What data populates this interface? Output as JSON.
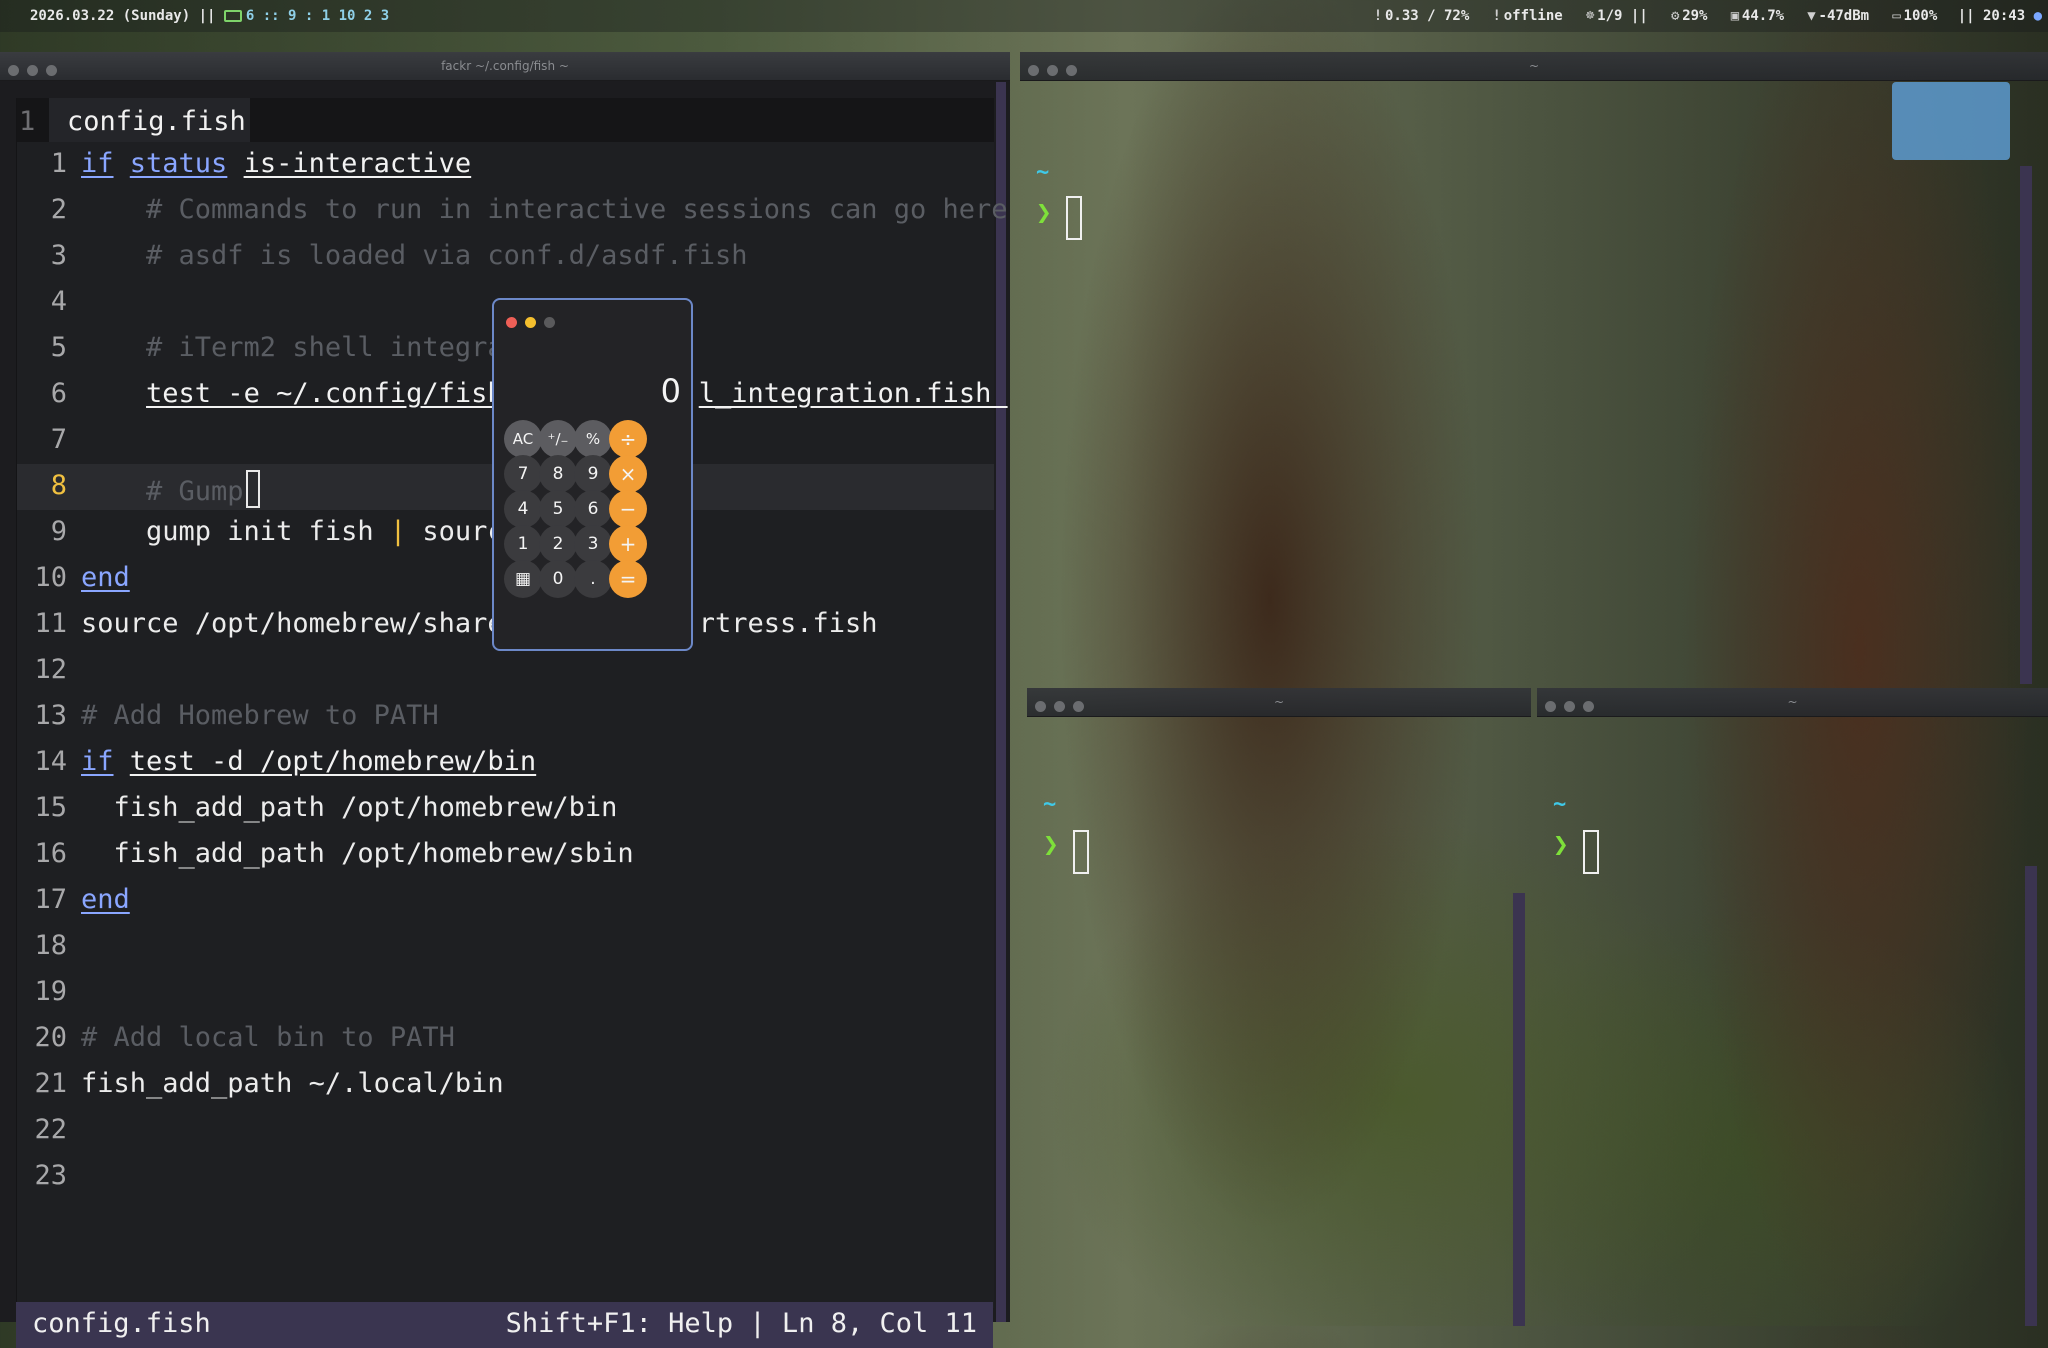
{
  "statusbar": {
    "date": "2026.03.22 (Sunday) ||",
    "workspaces": "6 :: 9 : 1 10 2 3",
    "load": "0.33 / 72%",
    "network_state": "offline",
    "containers": "1/9 ||",
    "cpu": "29%",
    "memory": "44.7%",
    "wifi": "-47dBm",
    "battery": "100%",
    "clock": "|| 20:43"
  },
  "editor_window": {
    "title": "fackr ~/.config/fish ~",
    "tab_number": "1",
    "tab_name": "config.fish",
    "lines": [
      {
        "n": "1",
        "segments": [
          {
            "t": "if",
            "c": "kw"
          },
          {
            "t": " "
          },
          {
            "t": "status",
            "c": "kw"
          },
          {
            "t": " "
          },
          {
            "t": "is-interactive",
            "c": "cmd"
          }
        ]
      },
      {
        "n": "2",
        "segments": [
          {
            "t": "    # Commands to run in interactive sessions can go here",
            "c": "cmt"
          }
        ]
      },
      {
        "n": "3",
        "segments": [
          {
            "t": "    # asdf is loaded via conf.d/asdf.fish",
            "c": "cmt"
          }
        ]
      },
      {
        "n": "4",
        "segments": []
      },
      {
        "n": "5",
        "segments": [
          {
            "t": "    # iTerm2 shell integra",
            "c": "cmt"
          }
        ]
      },
      {
        "n": "6",
        "segments": [
          {
            "t": "    "
          },
          {
            "t": "test -e ~/.config/fish",
            "c": "cmd"
          },
          {
            "t": "            "
          },
          {
            "t": "l_integration.fish ",
            "c": "cmd"
          }
        ]
      },
      {
        "n": "7",
        "segments": []
      },
      {
        "n": "8",
        "segments": [
          {
            "t": "    # Gump",
            "c": "cmt"
          }
        ],
        "cursor": true
      },
      {
        "n": "9",
        "segments": [
          {
            "t": "    gump init fish "
          },
          {
            "t": "|",
            "c": "pipe"
          },
          {
            "t": " sourc"
          }
        ]
      },
      {
        "n": "10",
        "segments": [
          {
            "t": "end",
            "c": "kw"
          }
        ]
      },
      {
        "n": "11",
        "segments": [
          {
            "t": "source /opt/homebrew/share"
          },
          {
            "t": "            rtress.fish"
          }
        ]
      },
      {
        "n": "12",
        "segments": []
      },
      {
        "n": "13",
        "segments": [
          {
            "t": "# Add Homebrew to PATH",
            "c": "cmt"
          }
        ]
      },
      {
        "n": "14",
        "segments": [
          {
            "t": "if",
            "c": "kw"
          },
          {
            "t": " "
          },
          {
            "t": "test -d /opt/homebrew/bin",
            "c": "cmd"
          }
        ]
      },
      {
        "n": "15",
        "segments": [
          {
            "t": "  fish_add_path /opt/homebrew/bin"
          }
        ]
      },
      {
        "n": "16",
        "segments": [
          {
            "t": "  fish_add_path /opt/homebrew/sbin"
          }
        ]
      },
      {
        "n": "17",
        "segments": [
          {
            "t": "end",
            "c": "kw"
          }
        ]
      },
      {
        "n": "18",
        "segments": []
      },
      {
        "n": "19",
        "segments": []
      },
      {
        "n": "20",
        "segments": [
          {
            "t": "# Add local bin to PATH",
            "c": "cmt"
          }
        ]
      },
      {
        "n": "21",
        "segments": [
          {
            "t": "fish_add_path ~/.local/bin"
          }
        ]
      },
      {
        "n": "22",
        "segments": []
      },
      {
        "n": "23",
        "segments": []
      }
    ],
    "current_line": "8",
    "status_left": "config.fish",
    "status_right": "Shift+F1: Help | Ln 8, Col 11"
  },
  "terminals": [
    {
      "title": "~",
      "tilde": "~",
      "prompt": "❯"
    },
    {
      "title": "~",
      "tilde": "~",
      "prompt": "❯"
    },
    {
      "title": "~",
      "tilde": "~",
      "prompt": "❯"
    }
  ],
  "calculator": {
    "display": "0",
    "traffic_colors": [
      "#ee5f57",
      "#f4bf2e",
      "#5a5a5c"
    ],
    "rows": [
      [
        {
          "label": "AC",
          "kind": "fn",
          "name": "all-clear"
        },
        {
          "label": "⁺∕₋",
          "kind": "fn",
          "name": "plus-minus"
        },
        {
          "label": "%",
          "kind": "fn",
          "name": "percent"
        },
        {
          "label": "÷",
          "kind": "op",
          "name": "divide"
        }
      ],
      [
        {
          "label": "7",
          "kind": "num",
          "name": "digit-7"
        },
        {
          "label": "8",
          "kind": "num",
          "name": "digit-8"
        },
        {
          "label": "9",
          "kind": "num",
          "name": "digit-9"
        },
        {
          "label": "×",
          "kind": "op",
          "name": "multiply"
        }
      ],
      [
        {
          "label": "4",
          "kind": "num",
          "name": "digit-4"
        },
        {
          "label": "5",
          "kind": "num",
          "name": "digit-5"
        },
        {
          "label": "6",
          "kind": "num",
          "name": "digit-6"
        },
        {
          "label": "−",
          "kind": "op",
          "name": "minus"
        }
      ],
      [
        {
          "label": "1",
          "kind": "num",
          "name": "digit-1"
        },
        {
          "label": "2",
          "kind": "num",
          "name": "digit-2"
        },
        {
          "label": "3",
          "kind": "num",
          "name": "digit-3"
        },
        {
          "label": "+",
          "kind": "op",
          "name": "plus"
        }
      ],
      [
        {
          "label": "▦",
          "kind": "num",
          "name": "calculator-mode-icon"
        },
        {
          "label": "0",
          "kind": "num",
          "name": "digit-0"
        },
        {
          "label": ".",
          "kind": "num",
          "name": "decimal"
        },
        {
          "label": "=",
          "kind": "op",
          "name": "equals"
        }
      ]
    ]
  }
}
